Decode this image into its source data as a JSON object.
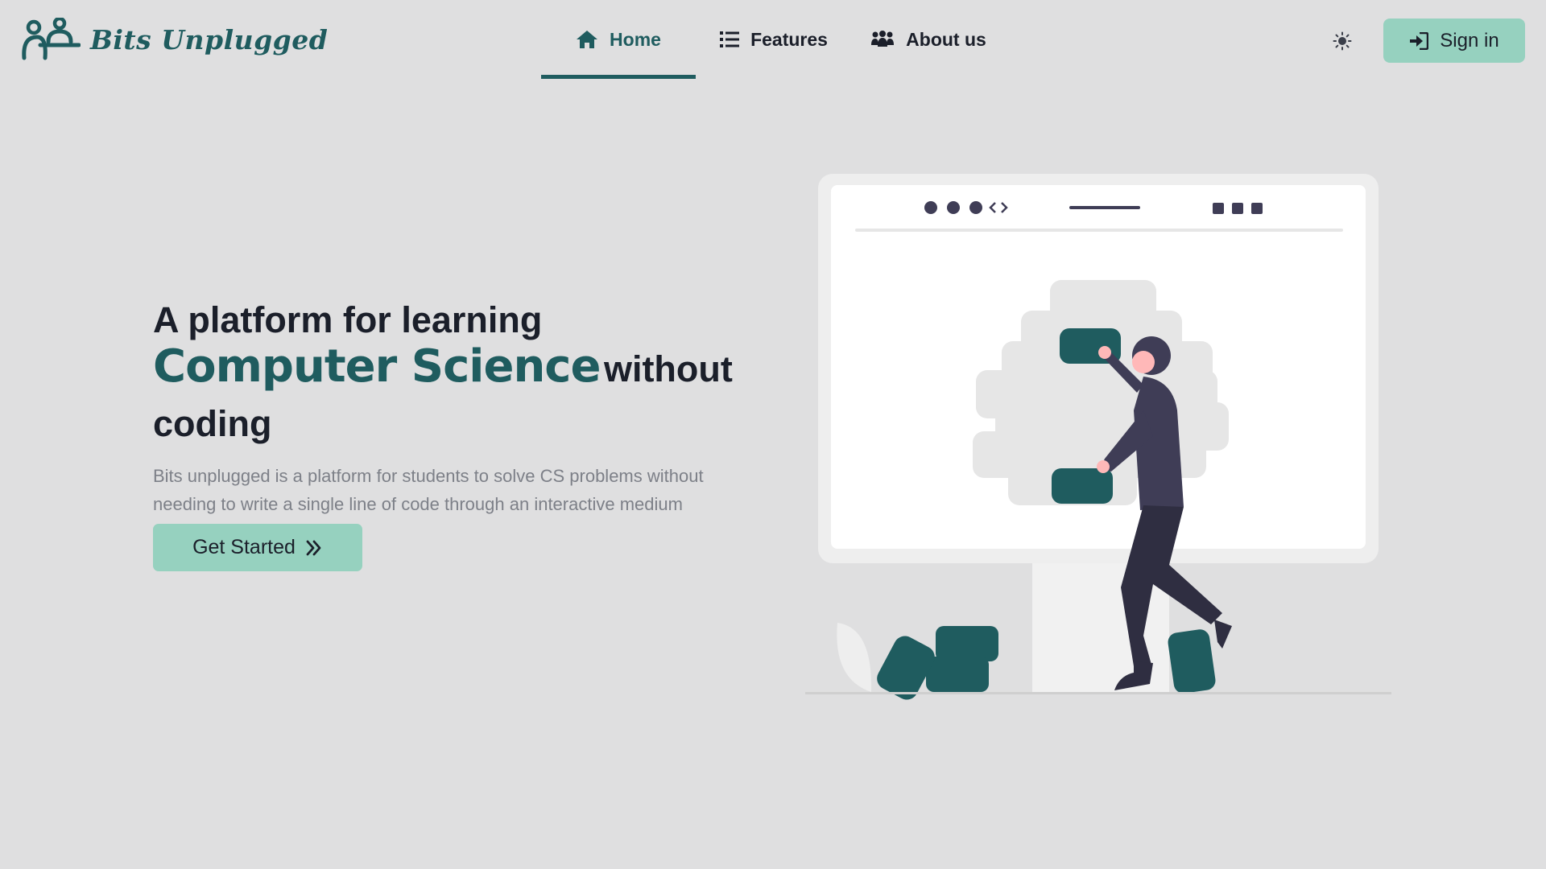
{
  "brand": {
    "name": "Bits Unplugged",
    "logo_icon": "people-icon"
  },
  "nav": {
    "items": [
      {
        "label": "Home",
        "icon": "home-icon",
        "active": true
      },
      {
        "label": "Features",
        "icon": "list-icon",
        "active": false
      },
      {
        "label": "About us",
        "icon": "users-icon",
        "active": false
      }
    ]
  },
  "header_actions": {
    "theme_icon": "sun-icon",
    "signin_label": "Sign in",
    "signin_icon": "sign-in-icon"
  },
  "hero": {
    "title_line1": "A platform for learning",
    "title_accent": "Computer Science",
    "title_rest": "without",
    "title_line3": "coding",
    "description": "Bits unplugged is a platform for students to solve CS problems without needing to write a single line of code through an interactive medium",
    "cta_label": "Get Started",
    "cta_icon": "double-chevron-right-icon"
  },
  "colors": {
    "background": "#dfdfe0",
    "brand": "#1f5c5f",
    "accent_button": "#96d1bf",
    "text_dark": "#1b1f2a",
    "text_muted": "#7d8088"
  }
}
